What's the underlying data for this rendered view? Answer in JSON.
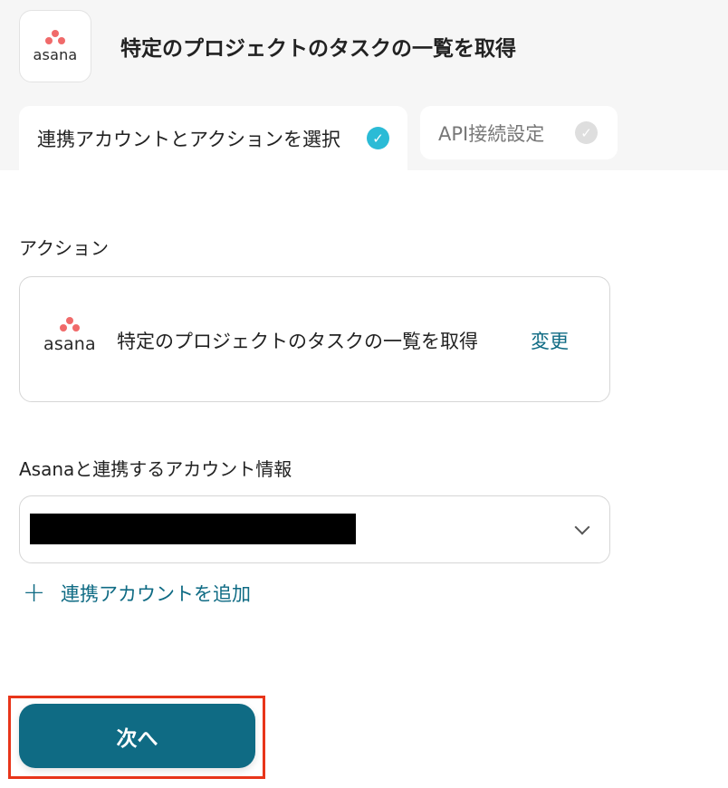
{
  "header": {
    "app_logo_text": "asana",
    "title": "特定のプロジェクトのタスクの一覧を取得"
  },
  "tabs": [
    {
      "label": "連携アカウントとアクションを選択",
      "state": "completed"
    },
    {
      "label": "API接続設定",
      "state": "pending"
    }
  ],
  "action_section": {
    "label": "アクション",
    "card": {
      "logo_text": "asana",
      "title": "特定のプロジェクトのタスクの一覧を取得",
      "change_label": "変更"
    }
  },
  "account_section": {
    "label": "Asanaと連携するアカウント情報",
    "selected_value": "",
    "add_account_label": "連携アカウントを追加"
  },
  "footer": {
    "next_label": "次へ"
  },
  "colors": {
    "accent": "#0f6b84",
    "check_active": "#2bbbd6",
    "highlight": "#e8351a",
    "asana_dot": "#f06a6a"
  }
}
